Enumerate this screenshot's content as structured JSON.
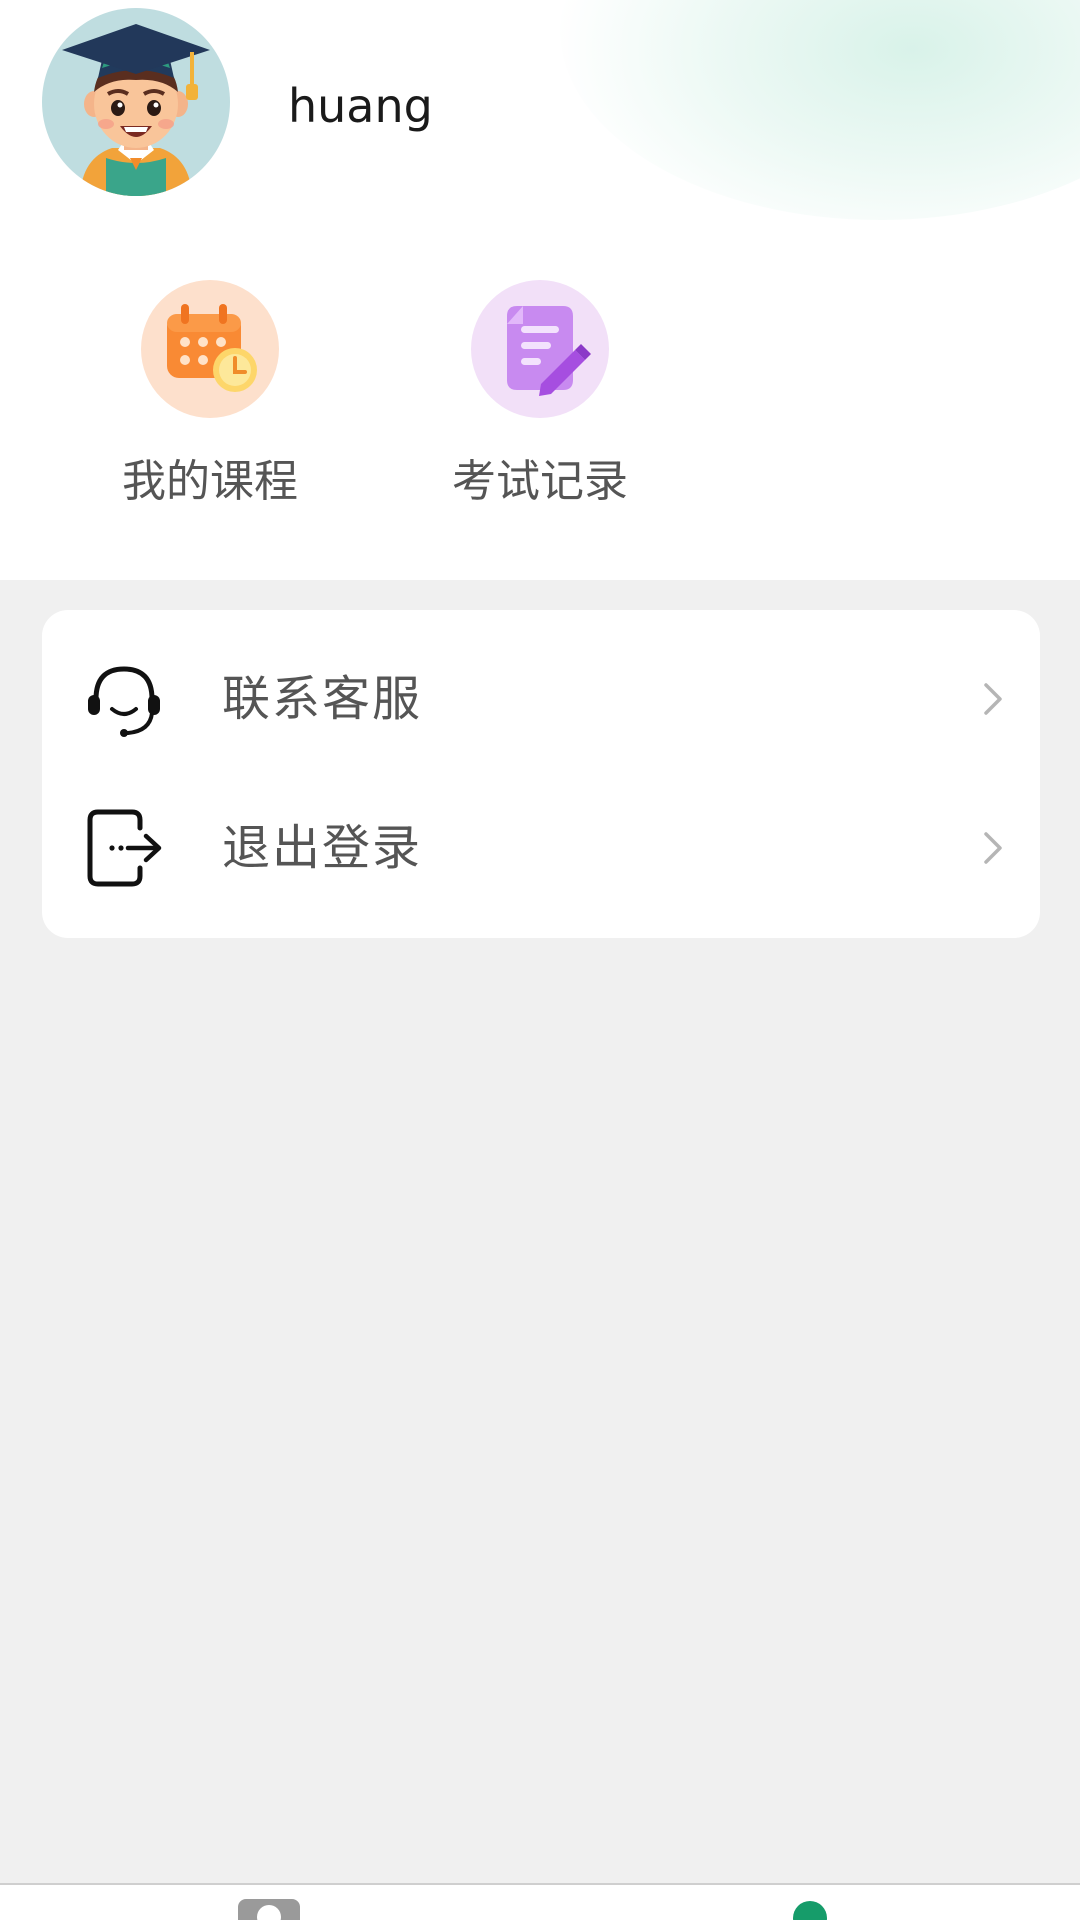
{
  "profile": {
    "username": "huang",
    "avatar_icon": "graduate-avatar-icon"
  },
  "quick_actions": [
    {
      "label": "我的课程",
      "icon": "calendar-clock-icon",
      "color": "#f97a2c"
    },
    {
      "label": "考试记录",
      "icon": "exam-edit-icon",
      "color": "#b25ee6"
    }
  ],
  "menu": [
    {
      "label": "联系客服",
      "icon": "headset-icon",
      "chevron": "chevron-right-icon"
    },
    {
      "label": "退出登录",
      "icon": "logout-icon",
      "chevron": "chevron-right-icon"
    }
  ],
  "tab_bar": {
    "active_color": "#169c6a",
    "inactive_color": "#9a9a9a",
    "tabs": [
      {
        "icon": "home-icon",
        "active": false
      },
      {
        "icon": "mine-icon",
        "active": true
      }
    ]
  }
}
